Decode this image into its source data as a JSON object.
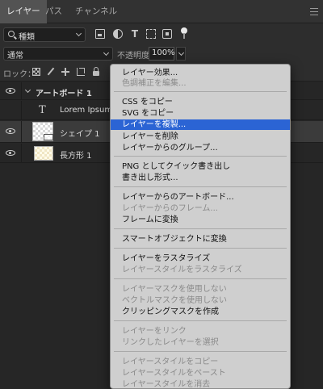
{
  "tabs": [
    {
      "label": "レイヤー",
      "active": true
    },
    {
      "label": "パス",
      "active": false
    },
    {
      "label": "チャンネル",
      "active": false
    }
  ],
  "filter": {
    "kind_label": "種類"
  },
  "blend": {
    "mode_label": "通常",
    "opacity_label": "不透明度：",
    "opacity_value": "100%"
  },
  "lock": {
    "label": "ロック："
  },
  "layers": [
    {
      "name": "アートボード 1",
      "type": "artboard"
    },
    {
      "name": "Lorem Ipsum",
      "type": "text"
    },
    {
      "name": "シェイプ 1",
      "type": "shape",
      "selected": true
    },
    {
      "name": "長方形 1",
      "type": "rectangle"
    }
  ],
  "menu": {
    "items": [
      {
        "label": "レイヤー効果...",
        "enabled": true
      },
      {
        "label": "色調補正を編集...",
        "enabled": false
      },
      {
        "label": "CSS をコピー",
        "enabled": true
      },
      {
        "label": "SVG をコピー",
        "enabled": true
      },
      {
        "label": "レイヤーを複製...",
        "enabled": true,
        "highlight": true
      },
      {
        "label": "レイヤーを削除",
        "enabled": true
      },
      {
        "label": "レイヤーからのグループ...",
        "enabled": true
      },
      {
        "label": "PNG としてクイック書き出し",
        "enabled": true
      },
      {
        "label": "書き出し形式...",
        "enabled": true
      },
      {
        "label": "レイヤーからのアートボード...",
        "enabled": true
      },
      {
        "label": "レイヤーからのフレーム...",
        "enabled": false
      },
      {
        "label": "フレームに変換",
        "enabled": true
      },
      {
        "label": "スマートオブジェクトに変換",
        "enabled": true
      },
      {
        "label": "レイヤーをラスタライズ",
        "enabled": true
      },
      {
        "label": "レイヤースタイルをラスタライズ",
        "enabled": false
      },
      {
        "label": "レイヤーマスクを使用しない",
        "enabled": false
      },
      {
        "label": "ベクトルマスクを使用しない",
        "enabled": false
      },
      {
        "label": "クリッピングマスクを作成",
        "enabled": true
      },
      {
        "label": "レイヤーをリンク",
        "enabled": false
      },
      {
        "label": "リンクしたレイヤーを選択",
        "enabled": false
      },
      {
        "label": "レイヤースタイルをコピー",
        "enabled": false
      },
      {
        "label": "レイヤースタイルをペースト",
        "enabled": false
      },
      {
        "label": "レイヤースタイルを消去",
        "enabled": false
      }
    ]
  },
  "colors": {
    "menu_highlight": "#2b64d4",
    "panel_bg": "#262626",
    "menu_bg": "#cfcfcf"
  }
}
